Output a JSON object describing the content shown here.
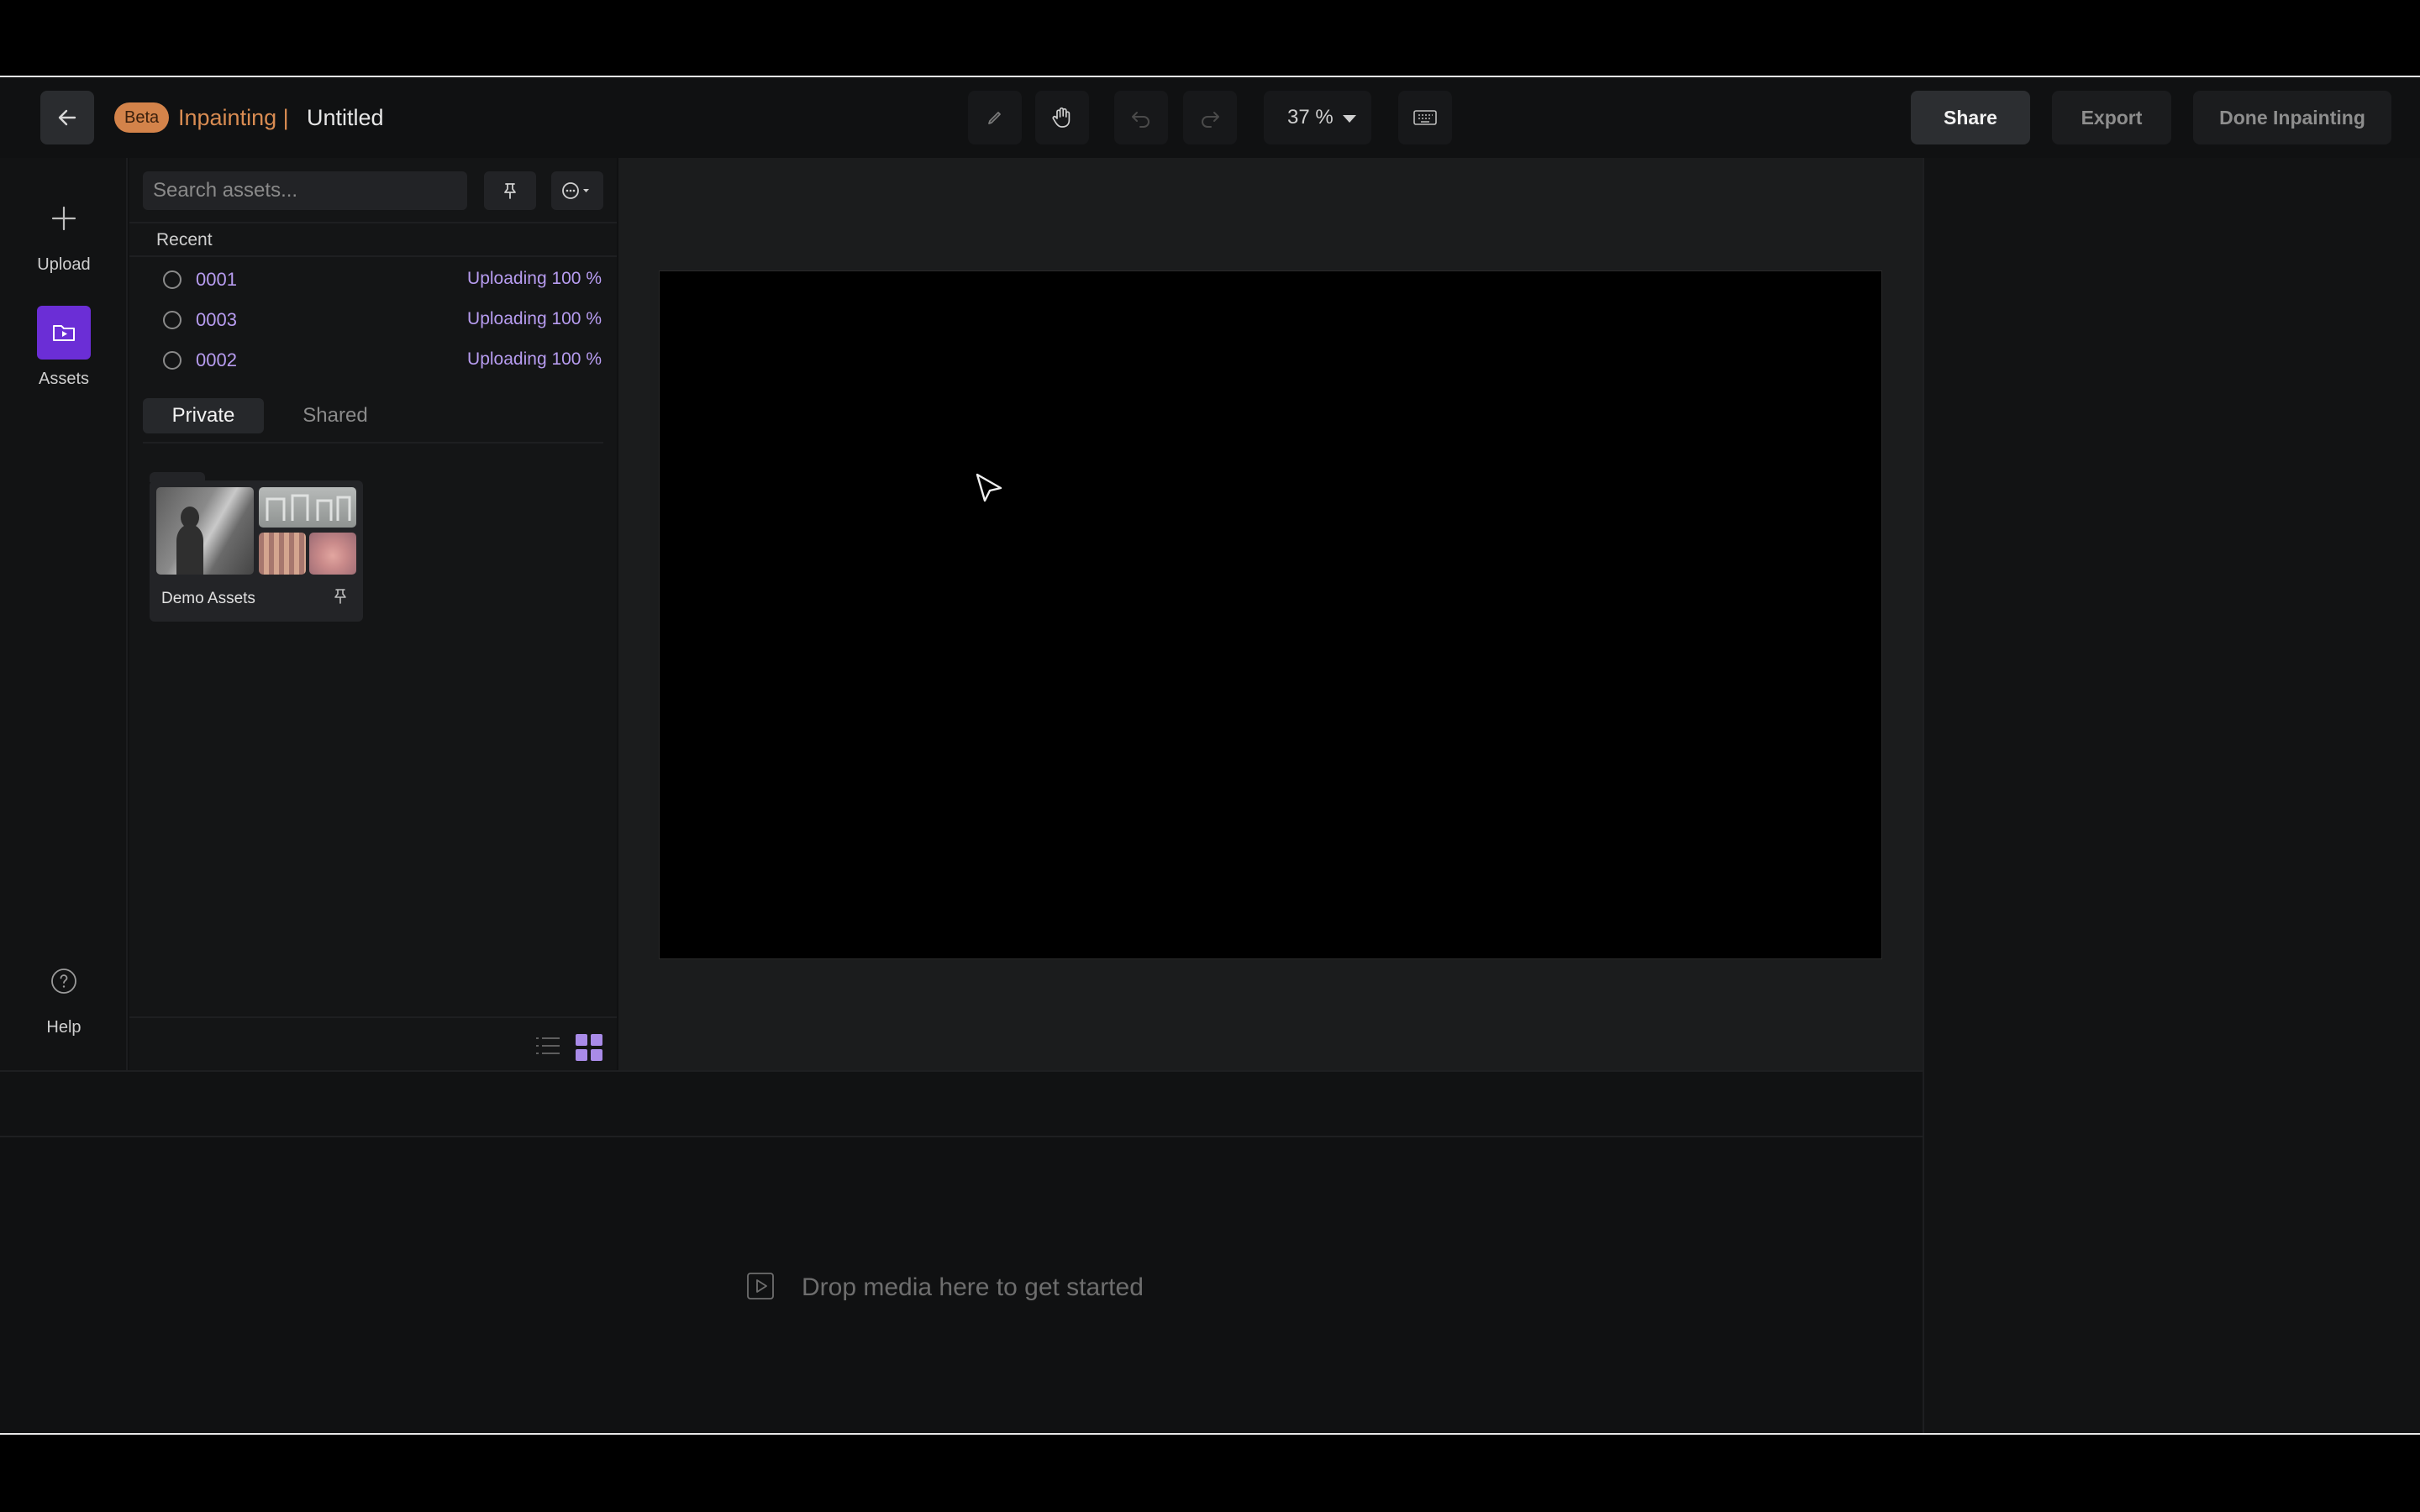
{
  "header": {
    "beta_badge": "Beta",
    "app_name": "Inpainting |",
    "doc_title": "Untitled",
    "zoom": "37 %",
    "share_label": "Share",
    "export_label": "Export",
    "done_label": "Done Inpainting"
  },
  "leftnav": {
    "upload_label": "Upload",
    "assets_label": "Assets",
    "help_label": "Help"
  },
  "assets": {
    "search_placeholder": "Search assets...",
    "recent_label": "Recent",
    "recent": [
      {
        "name": "0001",
        "status": "Uploading 100 %"
      },
      {
        "name": "0003",
        "status": "Uploading 100 %"
      },
      {
        "name": "0002",
        "status": "Uploading 100 %"
      }
    ],
    "tabs": {
      "private": "Private",
      "shared": "Shared"
    },
    "folder_name": "Demo Assets"
  },
  "timeline": {
    "drop_text": "Drop media here to get started"
  },
  "colors": {
    "accent": "#6b2ed6",
    "beta": "#d3834a",
    "upload_text": "#b79cf0"
  }
}
